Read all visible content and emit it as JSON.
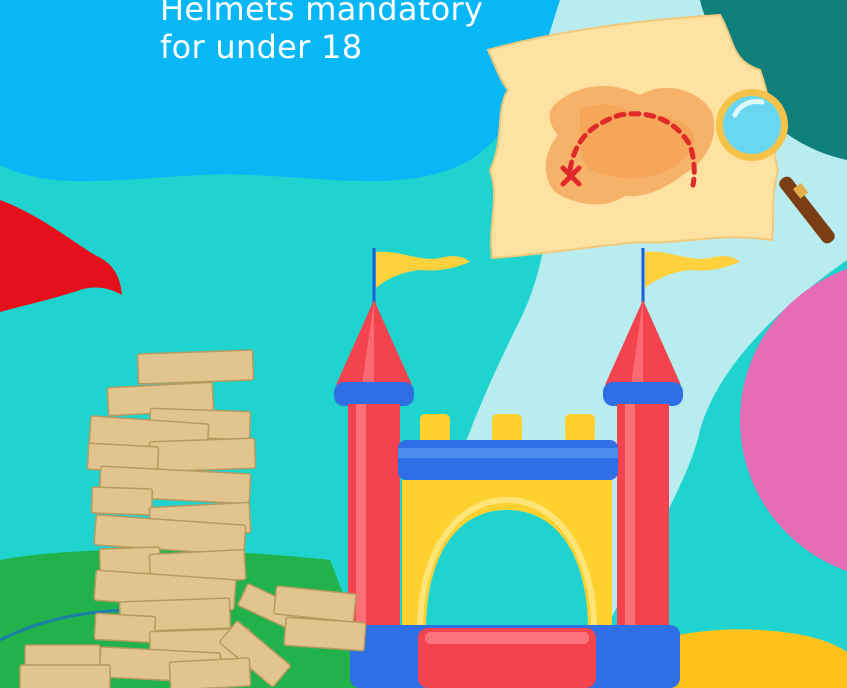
{
  "caption": {
    "line1": "Helmets mandatory",
    "line2": "for under 18"
  },
  "colors": {
    "background_teal": "#1fd3cf",
    "sky_blue": "#08b7f5",
    "light_blue": "#b9ecef",
    "dark_teal": "#0e7f7a",
    "pink": "#e66cb6",
    "red": "#e5101c",
    "green": "#22b24c",
    "yellow_ground": "#ffc21a",
    "castle_red": "#f2434e",
    "castle_blue": "#2f6fe6",
    "castle_yellow": "#ffd12e",
    "wood": "#e2c48e",
    "map_paper": "#fde2a2",
    "map_orange": "#f7b26a"
  },
  "icons": [
    "jenga-tower",
    "bouncy-castle",
    "treasure-map",
    "magnifying-glass",
    "pennant-flag"
  ]
}
